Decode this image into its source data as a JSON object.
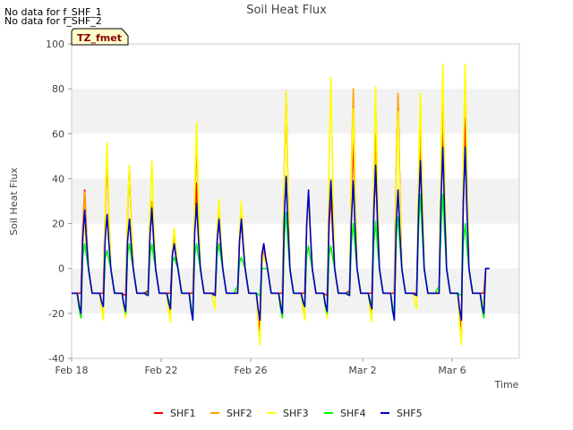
{
  "notes": [
    "No data for f_SHF_1",
    "No data for f_SHF_2"
  ],
  "chart_data": {
    "type": "line",
    "title": "Soil Heat Flux",
    "xlabel": "Time",
    "ylabel": "Soil Heat Flux",
    "tag": "TZ_fmet",
    "ylim": [
      -40,
      100
    ],
    "yticks": [
      -40,
      -20,
      0,
      20,
      40,
      60,
      80,
      100
    ],
    "xlim": [
      "2024-02-18",
      "2024-03-09"
    ],
    "xticks": [
      {
        "date": "2024-02-18",
        "label": "Feb 18"
      },
      {
        "date": "2024-02-22",
        "label": "Feb 22"
      },
      {
        "date": "2024-02-26",
        "label": "Feb 26"
      },
      {
        "date": "2024-03-02",
        "label": "Mar 2"
      },
      {
        "date": "2024-03-06",
        "label": "Mar 6"
      }
    ],
    "grid": "horizontal bands",
    "legend_position": "bottom",
    "series_daily_peaks": {
      "dates": [
        "2024-02-18",
        "2024-02-19",
        "2024-02-20",
        "2024-02-21",
        "2024-02-22",
        "2024-02-23",
        "2024-02-24",
        "2024-02-25",
        "2024-02-26",
        "2024-02-27",
        "2024-02-28",
        "2024-02-29",
        "2024-03-01",
        "2024-03-02",
        "2024-03-03",
        "2024-03-04",
        "2024-03-05",
        "2024-03-06",
        "2024-03-07"
      ],
      "series": [
        {
          "name": "SHF1",
          "color": "#ff0000",
          "values": [
            35,
            50,
            45,
            27,
            11,
            38,
            22,
            22,
            11,
            78,
            33,
            33,
            57,
            45,
            77,
            55,
            67,
            67,
            0
          ]
        },
        {
          "name": "SHF2",
          "color": "#ffa500",
          "values": [
            34,
            49,
            44,
            30,
            15,
            55,
            28,
            25,
            8,
            76,
            33,
            40,
            80,
            60,
            78,
            65,
            75,
            88,
            0
          ]
        },
        {
          "name": "SHF3",
          "color": "#ffff00",
          "values": [
            20,
            56,
            46,
            48,
            18,
            65,
            31,
            30,
            5,
            79,
            30,
            85,
            71,
            81,
            70,
            78,
            91,
            91,
            0
          ]
        },
        {
          "name": "SHF4",
          "color": "#00ff00",
          "values": [
            11,
            8,
            11,
            11,
            5,
            11,
            11,
            5,
            0,
            25,
            10,
            10,
            20,
            21,
            23,
            33,
            33,
            20,
            0
          ]
        },
        {
          "name": "SHF5",
          "color": "#0000cc",
          "values": [
            26,
            24,
            22,
            27,
            11,
            29,
            22,
            22,
            11,
            41,
            35,
            39,
            39,
            46,
            35,
            48,
            54,
            54,
            0
          ]
        }
      ]
    }
  }
}
